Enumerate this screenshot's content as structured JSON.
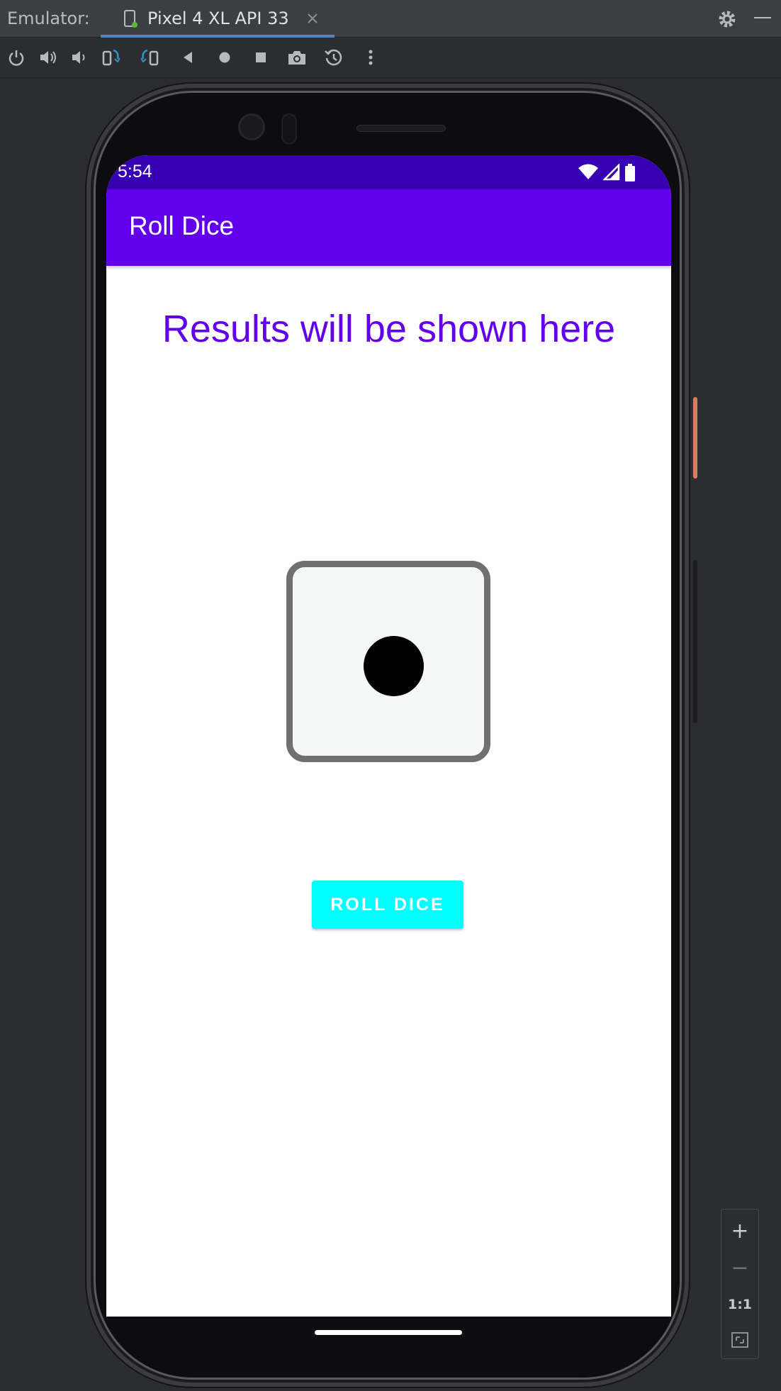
{
  "ide": {
    "label": "Emulator:",
    "tab": {
      "label": "Pixel 4 XL API 33"
    }
  },
  "toolbar": {
    "buttons": [
      "power-icon",
      "volume-up-icon",
      "volume-down-icon",
      "rotate-left-icon",
      "rotate-right-icon",
      "back-icon",
      "home-icon",
      "overview-icon",
      "screenshot-icon",
      "snapshot-icon",
      "more-icon"
    ]
  },
  "device": {
    "status": {
      "time": "5:54"
    },
    "app": {
      "title": "Roll Dice",
      "result_text": "Results will be shown here",
      "die_value": 1,
      "button_label": "ROLL DICE"
    }
  },
  "zoom": {
    "zoom_in": "+",
    "zoom_out": "−",
    "actual_size": "1:1"
  },
  "colors": {
    "status_bar": "#3700b3",
    "app_bar": "#6200ee",
    "result_text": "#6200ee",
    "button": "#00ffff"
  }
}
